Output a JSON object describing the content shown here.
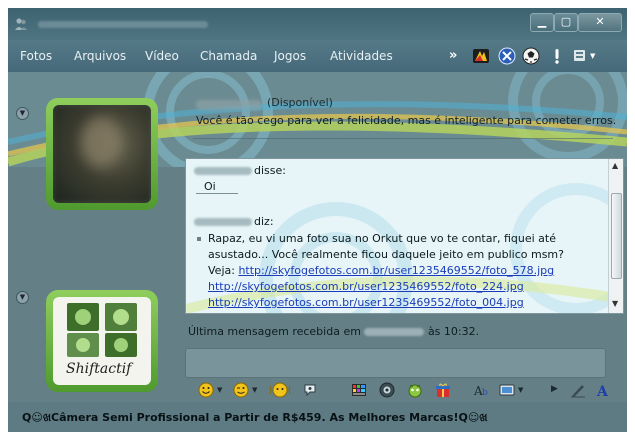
{
  "navbar": {
    "items": [
      "Fotos",
      "Arquivos",
      "Vídeo",
      "Chamada",
      "Jogos",
      "Atividades"
    ],
    "more_label": "»"
  },
  "window_controls": {
    "minimize": "▁",
    "maximize": "▢",
    "close": "✕"
  },
  "contact": {
    "status": "(Disponível)",
    "personal_message": "Você é tão cego para ver a felicidade, mas é inteligente para cometer erros."
  },
  "conversation": {
    "messages": [
      {
        "verb": "disse:",
        "lines": [
          "Oi"
        ]
      },
      {
        "verb": "diz:",
        "lines": [
          "Rapaz, eu vi uma foto sua no Orkut que vo te contar, fiquei até",
          "asustado... Você realmente ficou daquele jeito em publico msm?",
          "Veja: "
        ],
        "links": [
          "http://skyfogefotos.com.br/user1235469552/foto_578.jpg",
          "http://skyfogefotos.com.br/user1235469552/foto_224.jpg",
          "http://skyfogefotos.com.br/user1235469552/foto_004.jpg"
        ]
      }
    ]
  },
  "status_line": {
    "prefix": "Última mensagem recebida em",
    "middle": "às 10:32."
  },
  "user_avatar": {
    "caption": "Shiftactif"
  },
  "ad": {
    "text": "Q☺ଖCâmera Semi Profissional a Partir de R$459. As Melhores Marcas!Q☺ଖ"
  },
  "icons": {
    "toolbar": [
      "activities-icon",
      "windows-live-icon",
      "games-icon",
      "alert-icon",
      "menu-icon"
    ],
    "emoticons": [
      "smiley-icon",
      "wink-icon",
      "nudge-icon",
      "voice-clip-icon",
      "background-icon",
      "camera-icon",
      "wink-animation-icon",
      "gift-icon",
      "font-icon",
      "send-file-icon",
      "more-icon",
      "handwriting-icon",
      "font-style-icon"
    ]
  },
  "colors": {
    "accent_green": "#5fb030",
    "link_blue": "#1a3cb8",
    "chat_bg": "#e7f5f8"
  }
}
